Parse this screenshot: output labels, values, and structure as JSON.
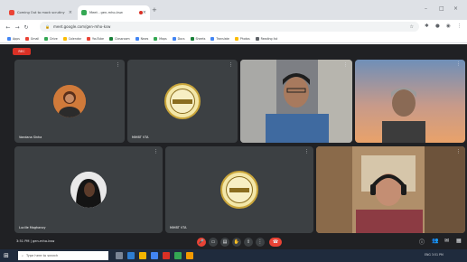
{
  "browser": {
    "tabs": [
      {
        "title": "Coming Out to mock scrutiny",
        "active": false,
        "color": "#ea4335"
      },
      {
        "title": "Meet - gen-mho-ksw",
        "active": true,
        "color": "#34a853"
      }
    ],
    "url": "meet.google.com/gen-mho-ksw",
    "bookmarks": [
      {
        "label": "Apps",
        "color": "#4285f4"
      },
      {
        "label": "Gmail",
        "color": "#ea4335"
      },
      {
        "label": "Drive",
        "color": "#34a853"
      },
      {
        "label": "Calendar",
        "color": "#fbbc04"
      },
      {
        "label": "YouTube",
        "color": "#ea4335"
      },
      {
        "label": "Classroom",
        "color": "#188038"
      },
      {
        "label": "News",
        "color": "#4285f4"
      },
      {
        "label": "Maps",
        "color": "#34a853"
      },
      {
        "label": "Docs",
        "color": "#4285f4"
      },
      {
        "label": "Sheets",
        "color": "#188038"
      },
      {
        "label": "Translate",
        "color": "#4285f4"
      },
      {
        "label": "Photos",
        "color": "#fbbc04"
      },
      {
        "label": "Reading list",
        "color": "#5f6368"
      }
    ]
  },
  "meet": {
    "rec_label": "REC",
    "participants": [
      {
        "name": "Vandana Sinha",
        "kind": "avatar"
      },
      {
        "name": "MIHBT VTA",
        "kind": "emblem"
      },
      {
        "name": "",
        "kind": "video-man"
      },
      {
        "name": "",
        "kind": "video-woman-sunset"
      },
      {
        "name": "Lucille Maghanoy",
        "kind": "avatar-dark"
      },
      {
        "name": "MIHBT VTA",
        "kind": "emblem"
      },
      {
        "name": "",
        "kind": "video-headset"
      }
    ],
    "meeting_code": "3:51 PM | gen-mho-ksw",
    "controls": [
      "mic",
      "camera",
      "captions",
      "raise-hand",
      "present",
      "more",
      "end-call"
    ]
  },
  "taskbar": {
    "search_placeholder": "Type here to search",
    "tray_text": "ENG  3:51 PM"
  }
}
